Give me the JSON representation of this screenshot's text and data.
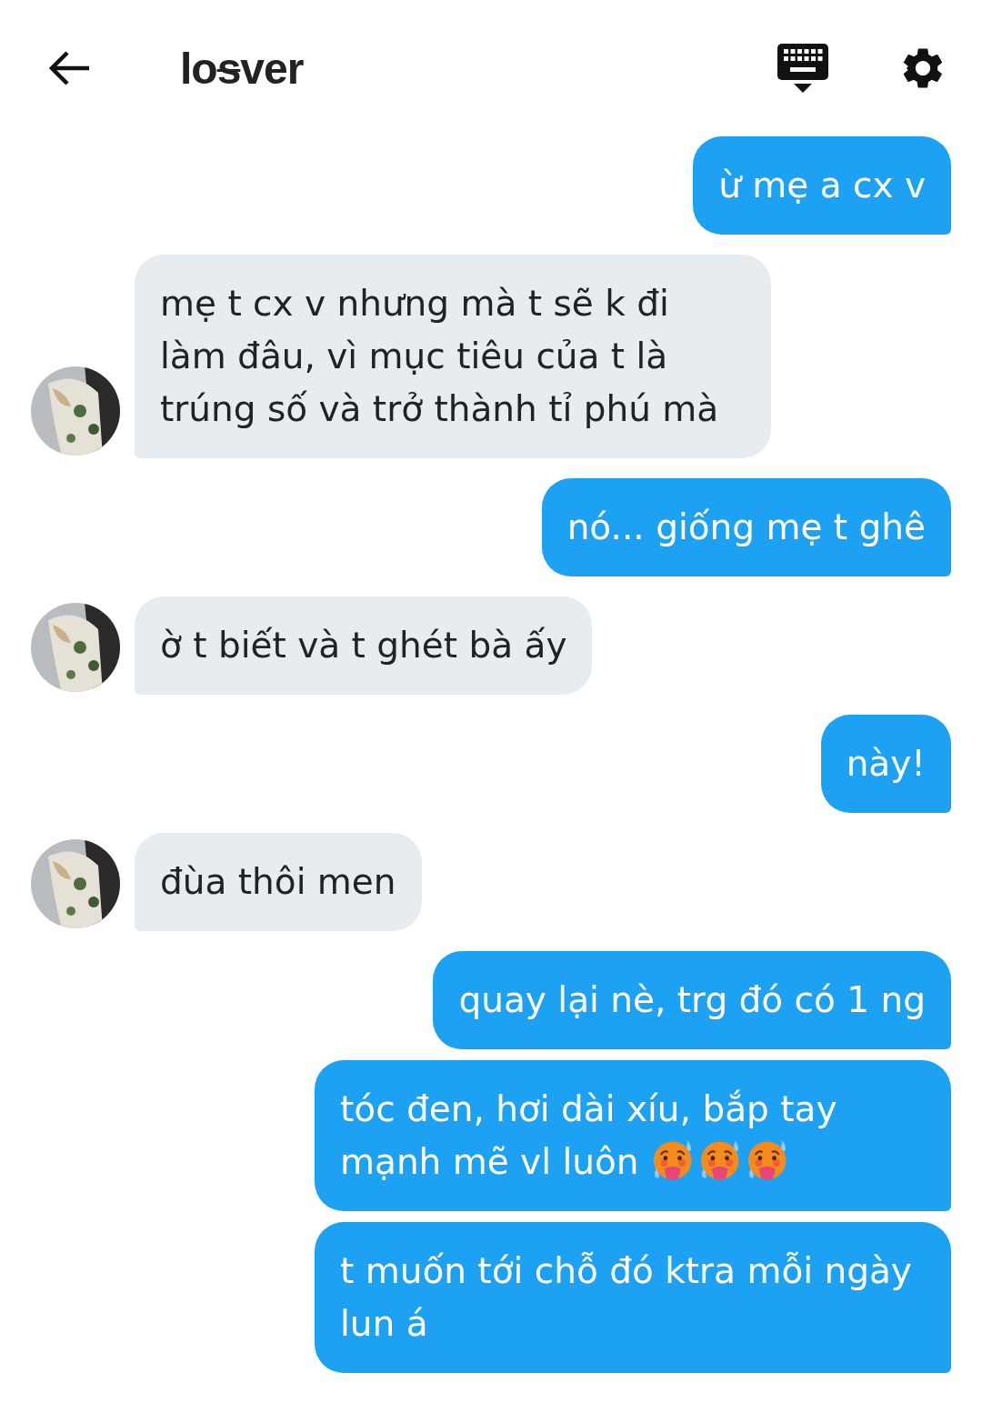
{
  "header": {
    "title_parts": [
      {
        "text": "lo",
        "struck": false
      },
      {
        "text": "s",
        "struck": true
      },
      {
        "text": "ver",
        "struck": false
      }
    ]
  },
  "messages": [
    {
      "kind": "outgoing",
      "text": "ừ mẹ a cx v"
    },
    {
      "kind": "incoming",
      "text": "mẹ t cx v nhưng mà t sẽ k đi làm đâu, vì mục tiêu của t là trúng số và trở thành tỉ phú mà"
    },
    {
      "kind": "outgoing",
      "text": "nó... giống mẹ t ghê"
    },
    {
      "kind": "incoming",
      "text": "ờ t biết và t ghét bà ấy"
    },
    {
      "kind": "outgoing",
      "text": "này!"
    },
    {
      "kind": "incoming",
      "text": "đùa thôi men"
    },
    {
      "kind": "outgoing",
      "text": "quay lại nè, trg đó có 1 ng"
    },
    {
      "kind": "outgoing",
      "text": "tóc đen, hơi dài xíu, bắp tay mạnh mẽ vl luôn",
      "emojis": [
        {
          "kind": "hot-face"
        },
        {
          "kind": "hot-face"
        },
        {
          "kind": "hot-face"
        }
      ]
    },
    {
      "kind": "outgoing",
      "text": "t muốn tới chỗ đó ktra mỗi ngày lun á"
    }
  ]
}
